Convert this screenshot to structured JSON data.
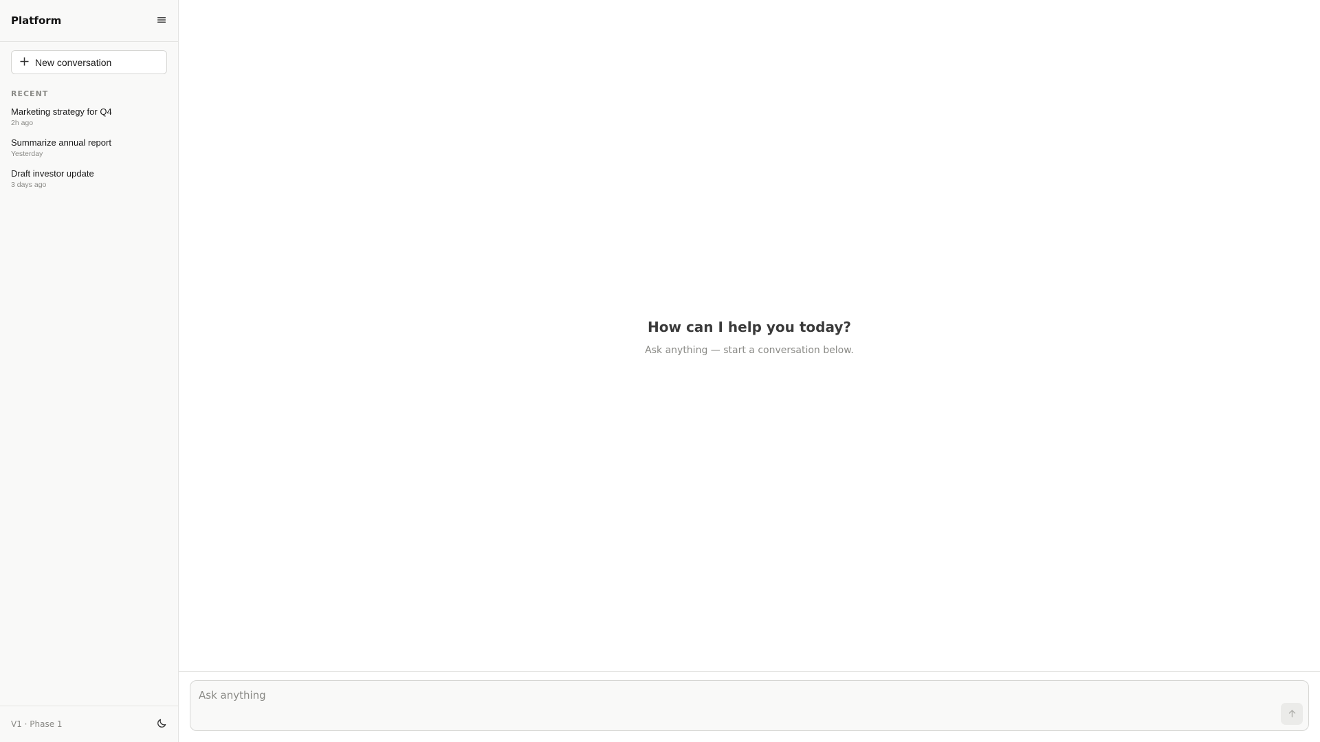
{
  "sidebar": {
    "brand": "Platform",
    "menu_icon": "menu-icon",
    "new_conversation": {
      "icon": "plus-icon",
      "label": "New conversation"
    },
    "section_label": "RECENT",
    "conversations": [
      {
        "title": "Marketing strategy for Q4",
        "time": "2h ago"
      },
      {
        "title": "Summarize annual report",
        "time": "Yesterday"
      },
      {
        "title": "Draft investor update",
        "time": "3 days ago"
      }
    ],
    "footer": {
      "version": "V1 · Phase 1",
      "theme_icon": "moon-icon"
    }
  },
  "main": {
    "welcome_title": "How can I help you today?",
    "welcome_subtitle": "Ask anything — start a conversation below.",
    "composer": {
      "placeholder": "Ask anything",
      "value": "",
      "send_icon": "arrow-up-icon"
    }
  },
  "colors": {
    "sidebar_bg": "#f9f9f8",
    "border": "#e4e4e2",
    "muted_text": "#8a8a86",
    "heading_text": "#3a3a3a"
  }
}
